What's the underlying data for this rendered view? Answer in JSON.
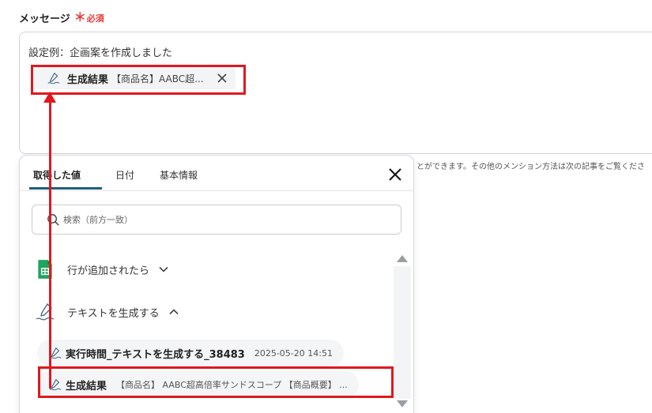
{
  "field": {
    "label": "メッセージ",
    "required_mark": "＊",
    "required_text": "必須"
  },
  "message": {
    "text": "設定例：企画案を作成しました",
    "chip_label": "生成結果",
    "chip_value": "【商品名】AABC超..."
  },
  "hint_text": "とができます。その他のメンション方法は次の記事をご覧くださ",
  "panel": {
    "tabs": [
      {
        "label": "取得した値",
        "active": true
      },
      {
        "label": "日付",
        "active": false
      },
      {
        "label": "基本情報",
        "active": false
      }
    ],
    "search_placeholder": "検索（前方一致）",
    "groups": [
      {
        "label": "行が追加されたら",
        "icon": "google-sheets-icon",
        "expanded": false
      },
      {
        "label": "テキストを生成する",
        "icon": "ai-pen-icon",
        "expanded": true
      }
    ],
    "items": [
      {
        "label": "実行時間_テキストを生成する_38483",
        "value": "2025-05-20 14:51"
      },
      {
        "label": "生成結果",
        "value": "【商品名】 AABC超高倍率サンドスコープ 【商品概要】 ..."
      }
    ]
  },
  "colors": {
    "highlight": "#e0181e",
    "required": "#e53935",
    "tab_underline": "#1f5f7a",
    "sheets_green": "#1fa463"
  }
}
